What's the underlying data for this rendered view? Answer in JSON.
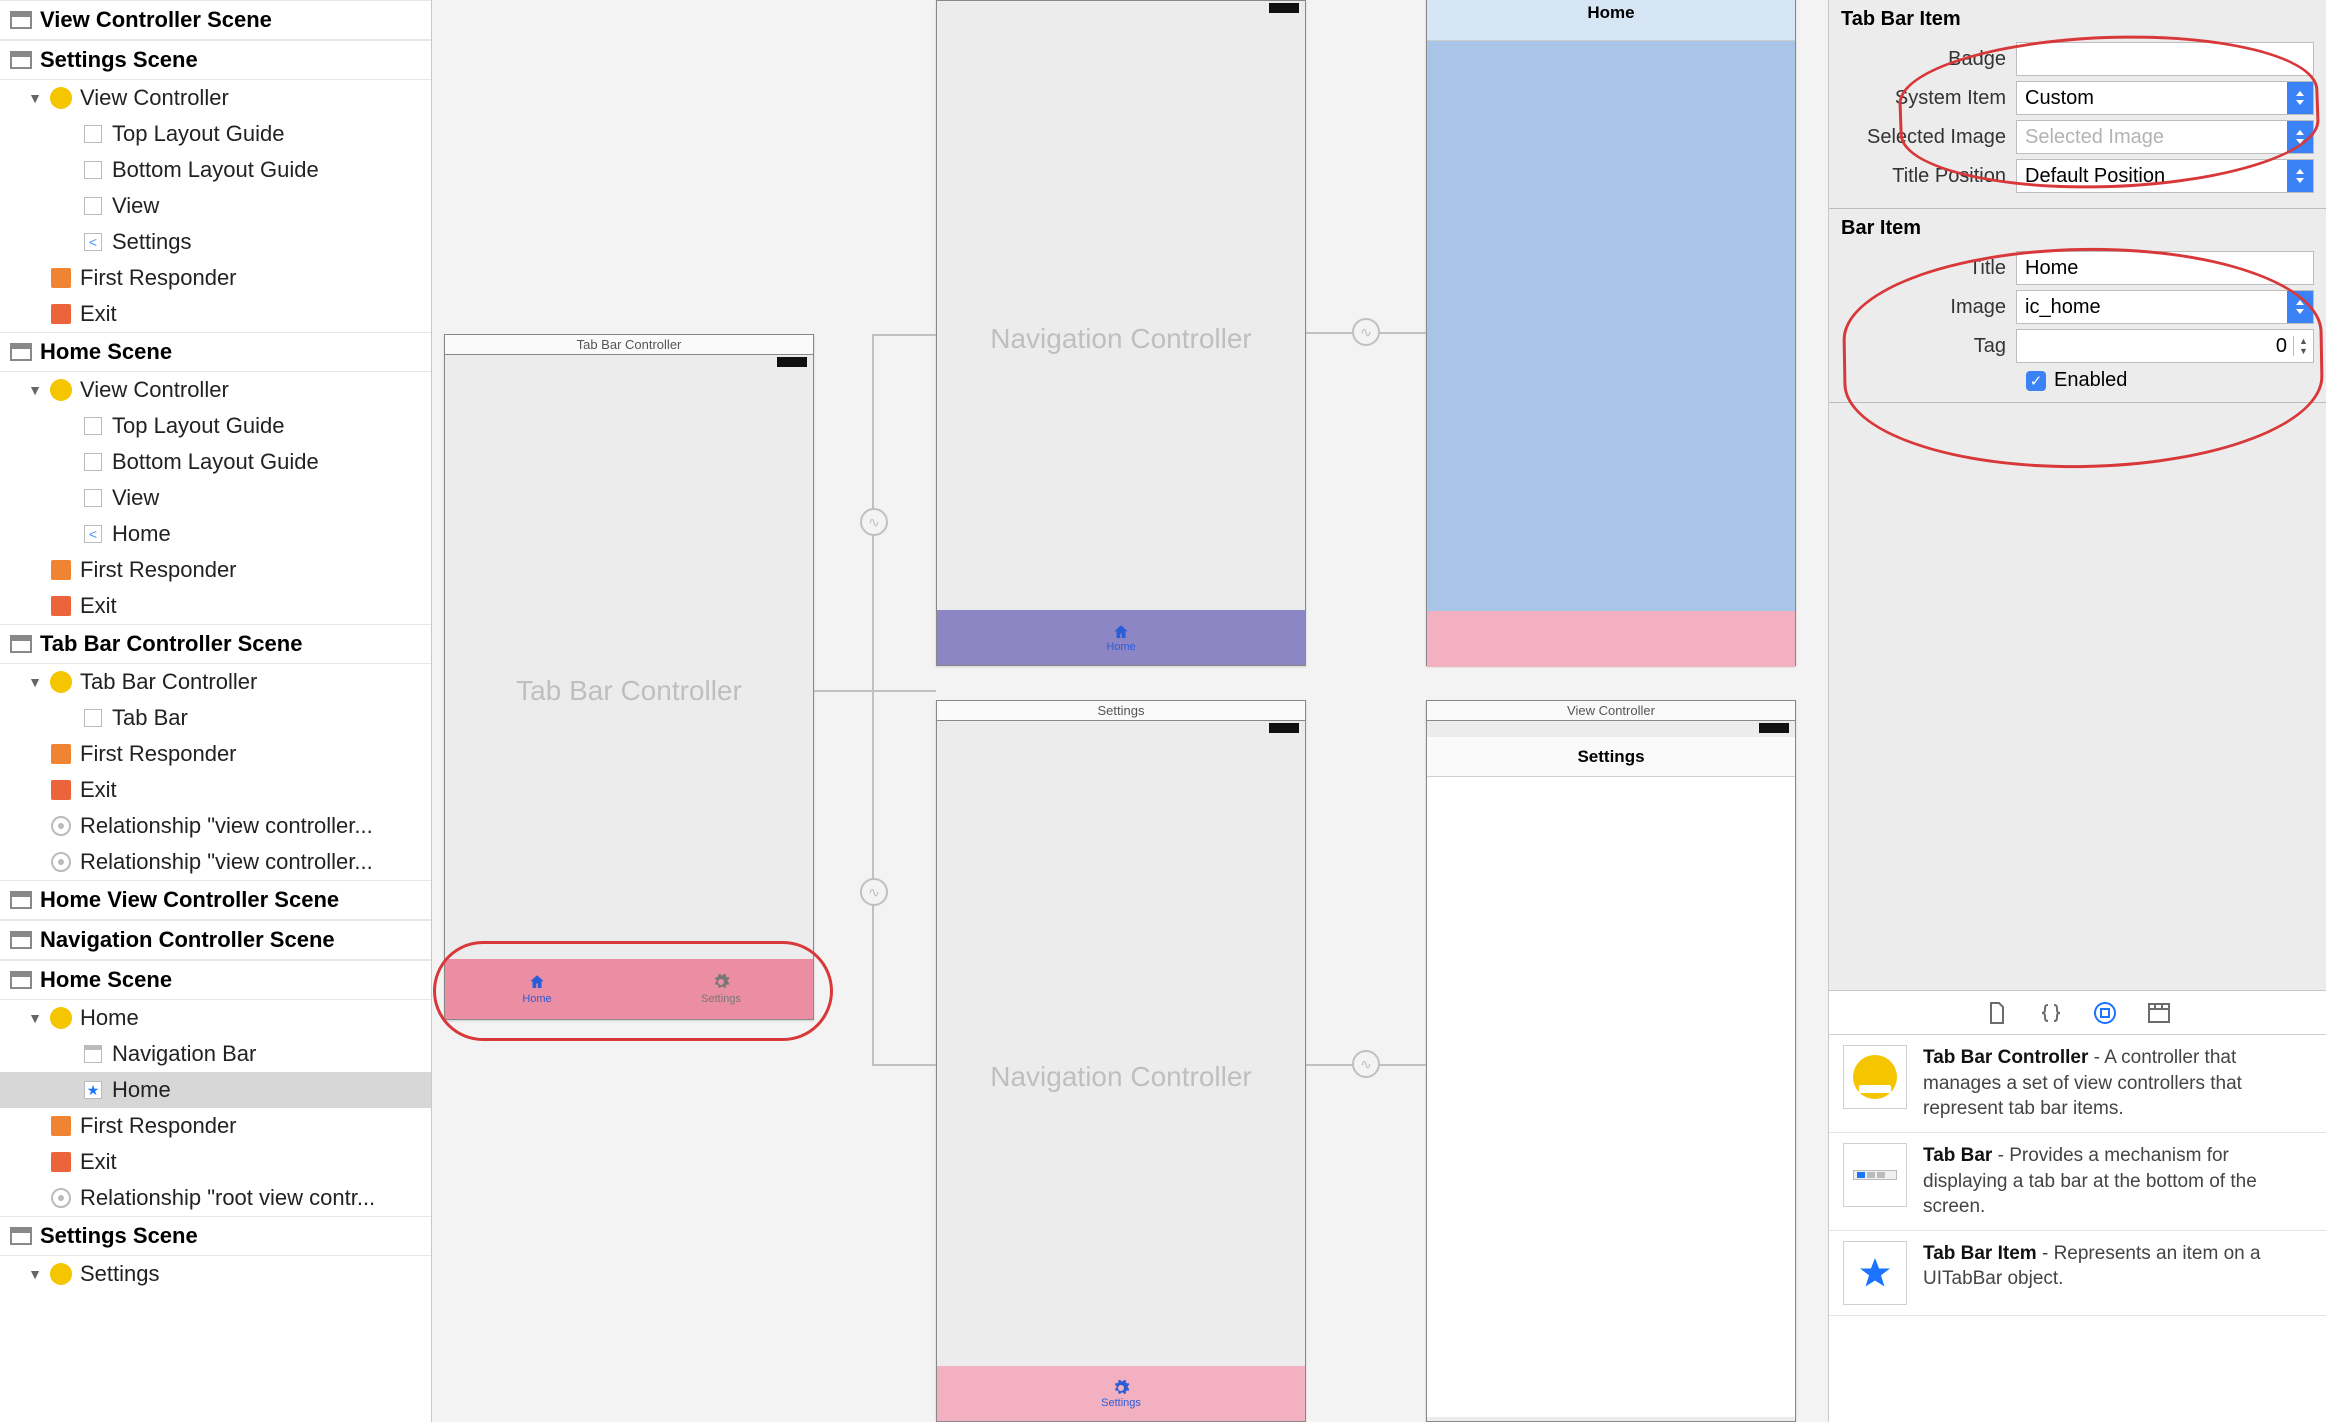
{
  "outline": {
    "scenes": [
      {
        "title": "View Controller Scene",
        "items": []
      },
      {
        "title": "Settings Scene",
        "items": [
          {
            "label": "View Controller",
            "icon": "circle-yellow",
            "depth": 1,
            "disclosure": "▼"
          },
          {
            "label": "Top Layout Guide",
            "icon": "sq-gray",
            "depth": 2
          },
          {
            "label": "Bottom Layout Guide",
            "icon": "sq-gray",
            "depth": 2
          },
          {
            "label": "View",
            "icon": "sq-gray",
            "depth": 2
          },
          {
            "label": "Settings",
            "icon": "sq-back",
            "depth": 2,
            "glyph": "<"
          },
          {
            "label": "First Responder",
            "icon": "cube-orange",
            "depth": 1
          },
          {
            "label": "Exit",
            "icon": "exit-red",
            "depth": 1
          }
        ]
      },
      {
        "title": "Home Scene",
        "items": [
          {
            "label": "View Controller",
            "icon": "circle-yellow",
            "depth": 1,
            "disclosure": "▼"
          },
          {
            "label": "Top Layout Guide",
            "icon": "sq-gray",
            "depth": 2
          },
          {
            "label": "Bottom Layout Guide",
            "icon": "sq-gray",
            "depth": 2
          },
          {
            "label": "View",
            "icon": "sq-gray",
            "depth": 2
          },
          {
            "label": "Home",
            "icon": "sq-back",
            "depth": 2,
            "glyph": "<"
          },
          {
            "label": "First Responder",
            "icon": "cube-orange",
            "depth": 1
          },
          {
            "label": "Exit",
            "icon": "exit-red",
            "depth": 1
          }
        ]
      },
      {
        "title": "Tab Bar Controller Scene",
        "items": [
          {
            "label": "Tab Bar Controller",
            "icon": "circle-yellow",
            "depth": 1,
            "disclosure": "▼"
          },
          {
            "label": "Tab Bar",
            "icon": "sq-gray",
            "depth": 2
          },
          {
            "label": "First Responder",
            "icon": "cube-orange",
            "depth": 1
          },
          {
            "label": "Exit",
            "icon": "exit-red",
            "depth": 1
          },
          {
            "label": "Relationship \"view controller...",
            "icon": "rel-dot",
            "depth": 1
          },
          {
            "label": "Relationship \"view controller...",
            "icon": "rel-dot",
            "depth": 1
          }
        ]
      },
      {
        "title": "Home View Controller Scene",
        "items": []
      },
      {
        "title": "Navigation Controller Scene",
        "items": []
      },
      {
        "title": "Home Scene",
        "items": [
          {
            "label": "Home",
            "icon": "circle-yellow",
            "depth": 1,
            "disclosure": "▼"
          },
          {
            "label": "Navigation Bar",
            "icon": "sq-navbar",
            "depth": 2
          },
          {
            "label": "Home",
            "icon": "sq-star",
            "depth": 2,
            "glyph": "★",
            "selected": true
          },
          {
            "label": "First Responder",
            "icon": "cube-orange",
            "depth": 1
          },
          {
            "label": "Exit",
            "icon": "exit-red",
            "depth": 1
          },
          {
            "label": "Relationship \"root view contr...",
            "icon": "rel-dot",
            "depth": 1
          }
        ]
      },
      {
        "title": "Settings Scene",
        "items": [
          {
            "label": "Settings",
            "icon": "circle-yellow",
            "depth": 1,
            "disclosure": "▼"
          }
        ]
      }
    ]
  },
  "canvas": {
    "tabbar_controller_title": "Tab Bar Controller",
    "tabbar_controller_placeholder": "Tab Bar Controller",
    "nav1_placeholder": "Navigation Controller",
    "nav2_title": "Settings",
    "nav2_placeholder": "Navigation Controller",
    "home_vc_navtitle": "Home",
    "settings_vc_title": "View Controller",
    "settings_vc_navtitle": "Settings",
    "tab_home": "Home",
    "tab_settings": "Settings",
    "nav_home_tab": "Home",
    "nav_settings_tab": "Settings"
  },
  "inspector": {
    "tabbar_item_title": "Tab Bar Item",
    "badge_label": "Badge",
    "badge_value": "",
    "system_item_label": "System Item",
    "system_item_value": "Custom",
    "selected_image_label": "Selected Image",
    "selected_image_placeholder": "Selected Image",
    "title_position_label": "Title Position",
    "title_position_value": "Default Position",
    "bar_item_title": "Bar Item",
    "title_label": "Title",
    "title_value": "Home",
    "image_label": "Image",
    "image_value": "ic_home",
    "tag_label": "Tag",
    "tag_value": "0",
    "enabled_label": "Enabled"
  },
  "library": {
    "items": [
      {
        "name": "Tab Bar Controller",
        "desc": " - A controller that manages a set of view controllers that represent tab bar items."
      },
      {
        "name": "Tab Bar",
        "desc": " - Provides a mechanism for displaying a tab bar at the bottom of the screen."
      },
      {
        "name": "Tab Bar Item",
        "desc": " - Represents an item on a UITabBar object."
      }
    ]
  }
}
